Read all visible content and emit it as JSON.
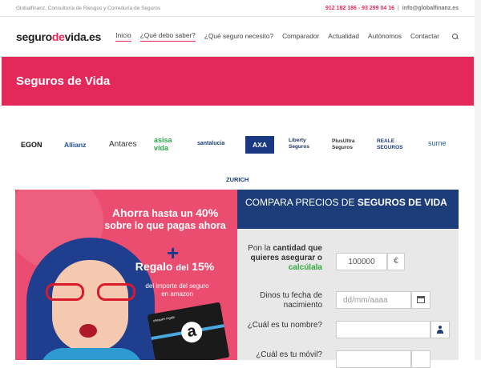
{
  "topbar": {
    "tagline": "Globalfinanz, Consultoría de Riesgos y Correduría de Seguros",
    "phones": "912 182 186 - 93 299 04 16",
    "separator": "|",
    "email": "info@globalfinanz.es"
  },
  "header": {
    "logo": {
      "part1": "seguro",
      "part2": "de",
      "part3": "vida.es"
    },
    "nav": [
      {
        "label": "Inicio"
      },
      {
        "label": "¿Qué debo saber?"
      },
      {
        "label": "¿Qué seguro necesito?"
      },
      {
        "label": "Comparador"
      },
      {
        "label": "Actualidad"
      },
      {
        "label": "Autónomos"
      },
      {
        "label": "Contactar"
      }
    ]
  },
  "hero": {
    "title": "Seguros de Vida"
  },
  "insurers": [
    "EGON",
    "Allianz",
    "Antares",
    "asisa vida",
    "santalucia",
    "AXA",
    "Liberty Seguros",
    "PlusUltra Seguros",
    "REALE SEGUROS",
    "surne",
    "ZURICH"
  ],
  "promo": {
    "line1a": "Ahorra",
    "line1b": "hasta un",
    "line1c": "40%",
    "line2": "sobre lo que pagas ahora",
    "plus": "+",
    "line3a": "Regalo",
    "line3b": "del",
    "line3c": "15%",
    "line4": "del importe del seguro",
    "line5": "en amazon",
    "card_label": "cheques regalo",
    "card_logo": "a"
  },
  "form": {
    "head_light": "COMPARA PRECIOS DE",
    "head_bold": "SEGUROS DE VIDA",
    "amount": {
      "label_pre": "Pon la",
      "label_bold": "cantidad que quieres asegurar",
      "label_post": "o",
      "label_link": "calcúlala",
      "value": "100000",
      "unit": "€"
    },
    "birth": {
      "label": "Dinos tu fecha de nacimiento",
      "placeholder": "dd/mm/aaaa"
    },
    "name": {
      "label": "¿Cuál es tu nombre?",
      "placeholder": ""
    },
    "mobile": {
      "label": "¿Cuál es tu móvil?",
      "placeholder": ""
    }
  },
  "colors": {
    "brand": "#e5285a",
    "navy": "#1c3d7a",
    "green": "#2faa3f"
  }
}
